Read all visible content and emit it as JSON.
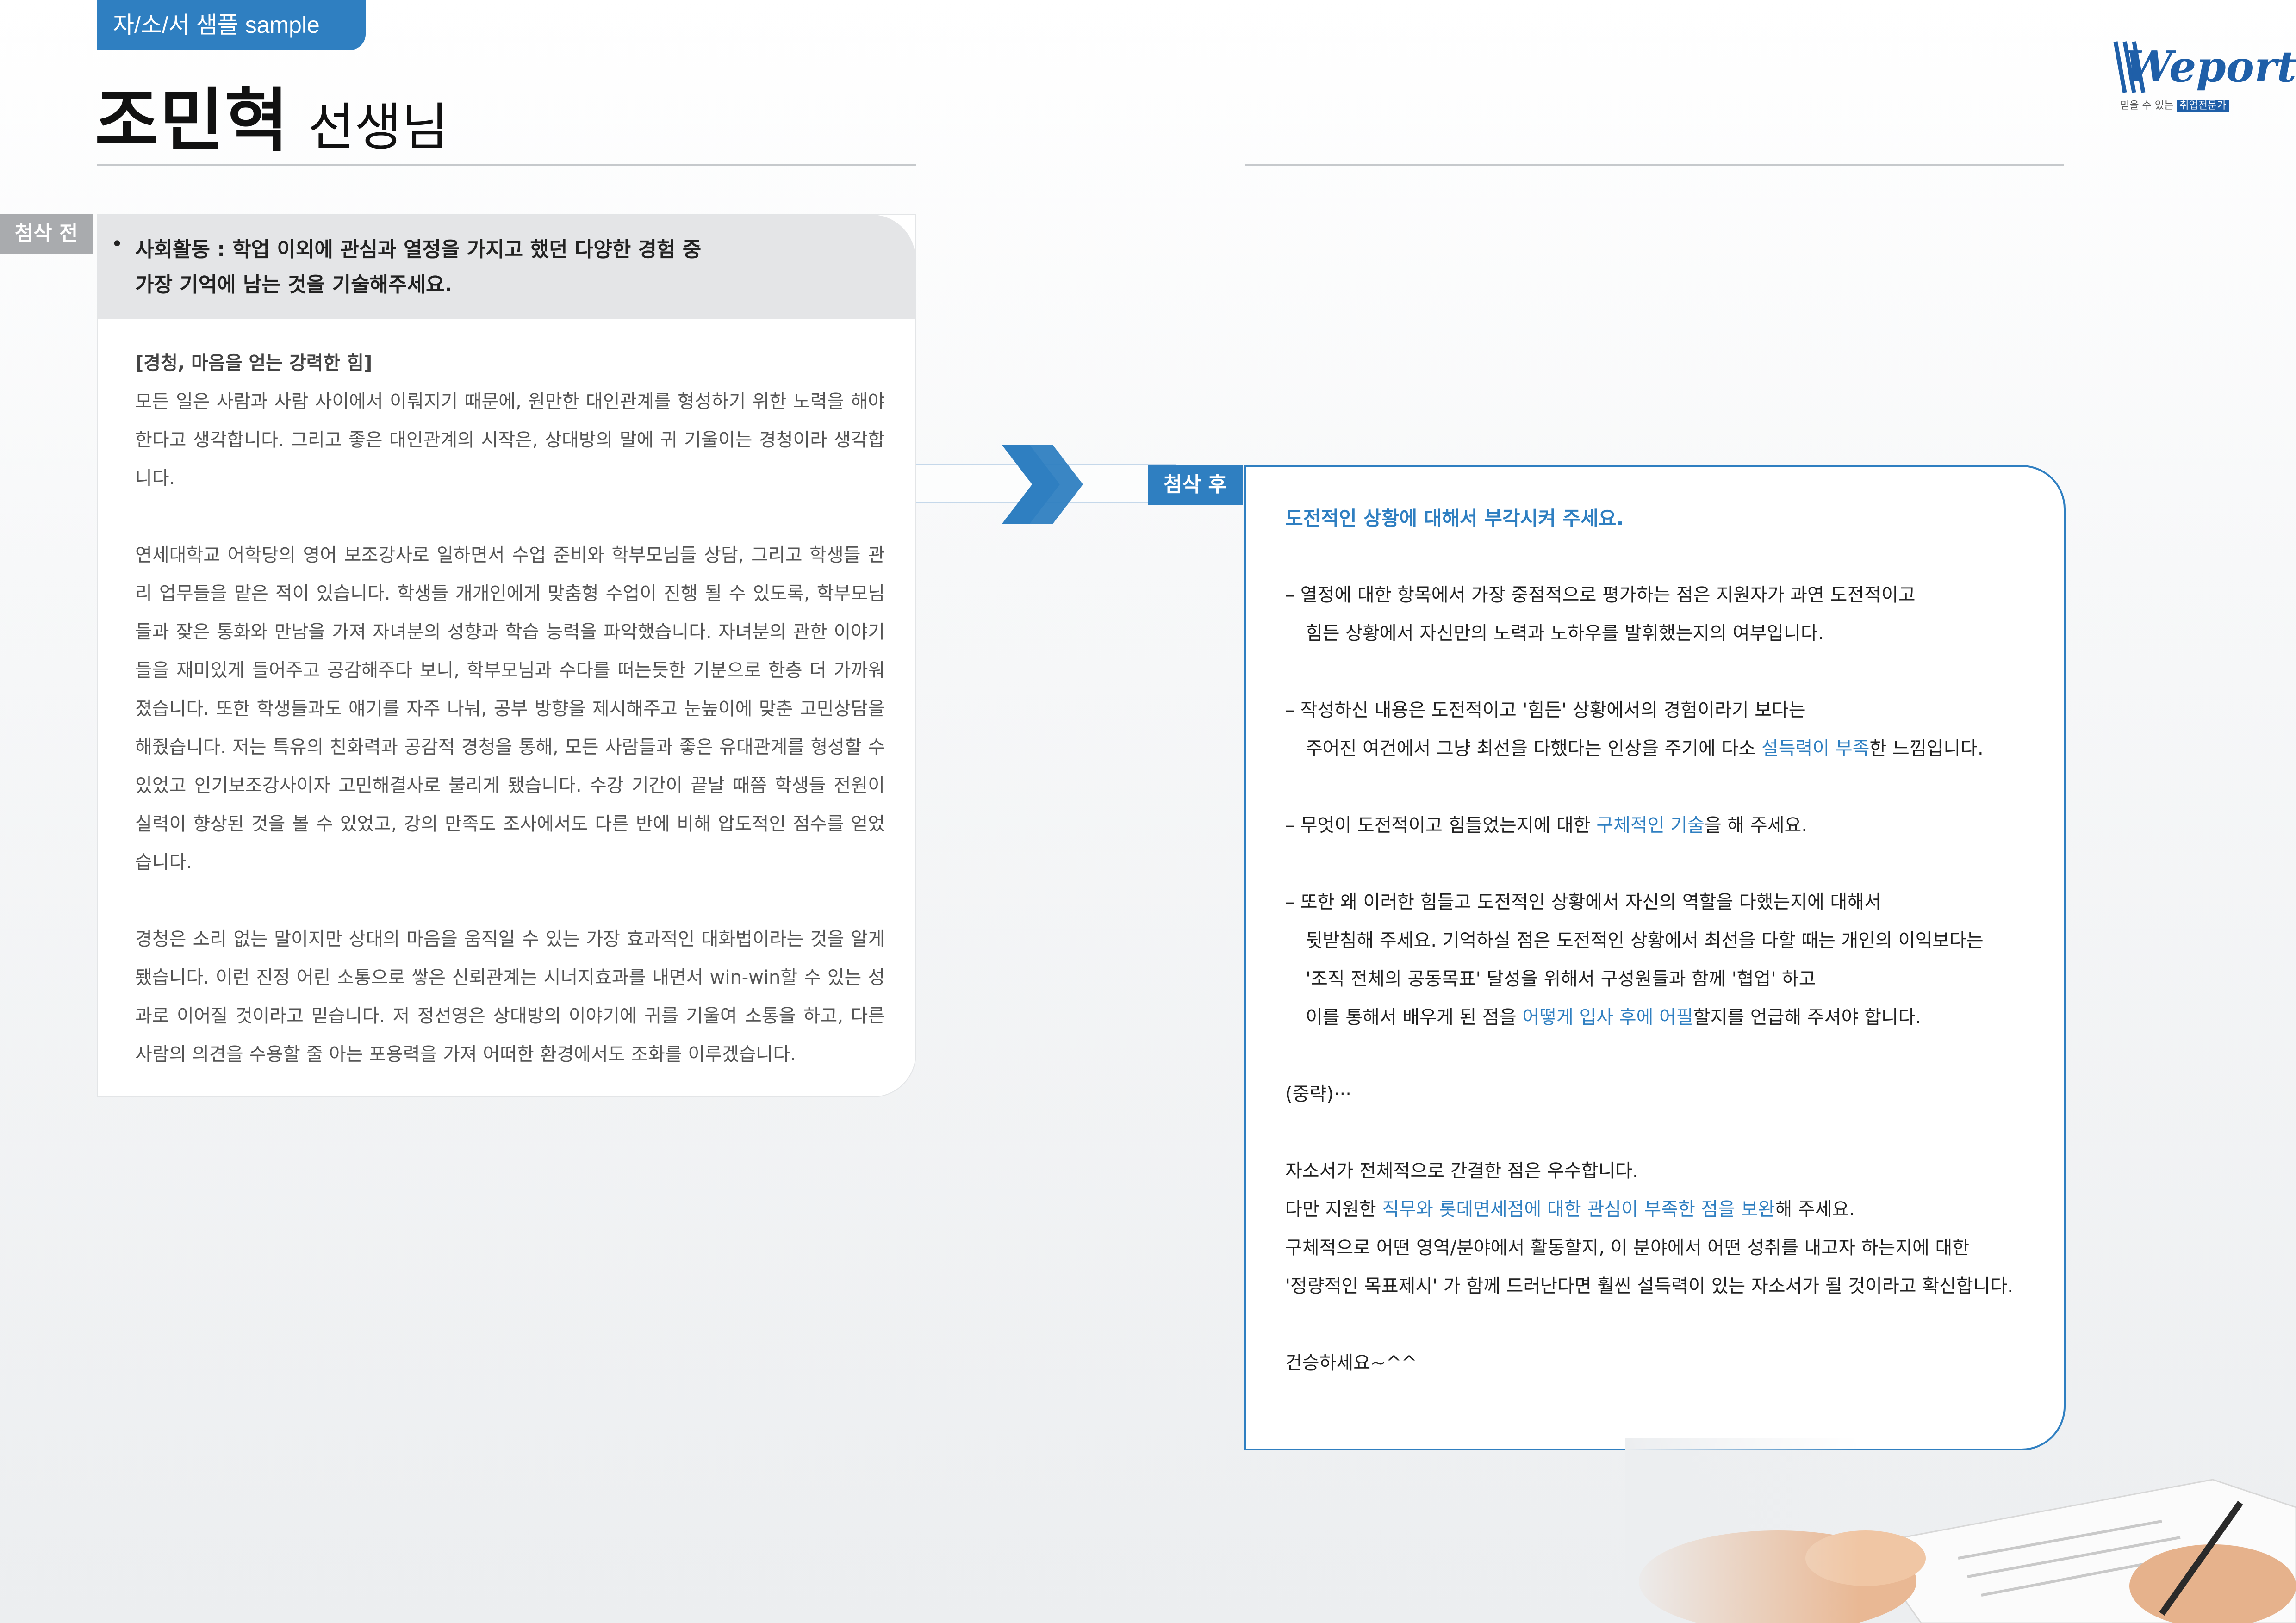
{
  "header": {
    "tag": "자/소/서 샘플 sample",
    "name": "조민혁",
    "suffix": "선생님"
  },
  "logo": {
    "word": "Weport",
    "tagline": "믿을 수 있는",
    "tagline_highlight": "취업전문가"
  },
  "before": {
    "label": "첨삭 전",
    "question_line1": "사회활동 : 학업 이외에 관심과 열정을 가지고 했던 다양한 경험 중",
    "question_line2": "가장 기억에 남는 것을 기술해주세요.",
    "heading": "[경청, 마음을 얻는 강력한 힘]",
    "paragraph1": "모든 일은 사람과 사람 사이에서 이뤄지기 때문에, 원만한 대인관계를 형성하기 위한 노력을 해야 한다고 생각합니다. 그리고 좋은 대인관계의 시작은, 상대방의 말에 귀 기울이는 경청이라 생각합니다.",
    "paragraph2": "연세대학교 어학당의 영어 보조강사로 일하면서 수업 준비와 학부모님들 상담, 그리고 학생들 관리 업무들을 맡은 적이 있습니다. 학생들 개개인에게 맞춤형 수업이 진행 될 수 있도록, 학부모님들과 잦은 통화와 만남을 가져 자녀분의 성향과 학습 능력을 파악했습니다. 자녀분의 관한 이야기들을 재미있게 들어주고 공감해주다 보니, 학부모님과 수다를 떠는듯한 기분으로 한층 더 가까워졌습니다. 또한 학생들과도 얘기를 자주 나눠, 공부 방향을 제시해주고 눈높이에 맞춘 고민상담을 해줬습니다. 저는 특유의 친화력과 공감적 경청을 통해, 모든 사람들과 좋은 유대관계를 형성할 수 있었고 인기보조강사이자 고민해결사로 불리게 됐습니다. 수강 기간이 끝날 때쯤 학생들 전원이 실력이 향상된 것을 볼 수 있었고, 강의 만족도 조사에서도 다른 반에 비해 압도적인 점수를 얻었습니다.",
    "paragraph3": "경청은 소리 없는 말이지만 상대의 마음을 움직일 수 있는 가장 효과적인 대화법이라는 것을 알게 됐습니다. 이런 진정 어린 소통으로 쌓은 신뢰관계는 시너지효과를 내면서 win-win할 수 있는 성과로 이어질 것이라고 믿습니다. 저 정선영은 상대방의 이야기에 귀를 기울여 소통을 하고, 다른 사람의 의견을 수용할 줄 아는 포용력을 가져 어떠한 환경에서도 조화를 이루겠습니다."
  },
  "after": {
    "label": "첨삭 후",
    "lead": "도전적인 상황에 대해서 부각시켜 주세요.",
    "item1_line1": "– 열정에 대한 항목에서 가장 중점적으로 평가하는 점은 지원자가 과연 도전적이고",
    "item1_line2": "힘든 상황에서 자신만의 노력과 노하우를 발휘했는지의 여부입니다.",
    "item2_line1": "– 작성하신 내용은 도전적이고 '힘든' 상황에서의 경험이라기 보다는",
    "item2_line2_a": "주어진 여건에서 그냥 최선을 다했다는 인상을 주기에 다소 ",
    "item2_line2_hl": "설득력이 부족",
    "item2_line2_b": "한 느낌입니다.",
    "item3_a": "– 무엇이 도전적이고 힘들었는지에 대한 ",
    "item3_hl": "구체적인 기술",
    "item3_b": "을 해 주세요.",
    "item4_line1": "– 또한 왜 이러한 힘들고 도전적인 상황에서 자신의 역할을 다했는지에 대해서",
    "item4_line2": "뒷받침해 주세요. 기억하실 점은 도전적인 상황에서 최선을 다할 때는 개인의 이익보다는",
    "item4_line3": "'조직 전체의 공동목표' 달성을 위해서 구성원들과 함께 '협업' 하고",
    "item4_line4_a": "이를 통해서 배우게 된 점을 ",
    "item4_line4_hl": "어떻게 입사 후에 어필",
    "item4_line4_b": "할지를 언급해 주셔야 합니다.",
    "omitted": "(중략)···",
    "close1": "자소서가 전체적으로 간결한 점은 우수합니다.",
    "close2_a": "다만 지원한 ",
    "close2_hl": "직무와 롯데면세점에 대한 관심이 부족한 점을 보완",
    "close2_b": "해 주세요.",
    "close3": "구체적으로 어떤 영역/분야에서 활동할지, 이 분야에서 어떤 성취를 내고자 하는지에 대한",
    "close4": "'정량적인 목표제시' 가 함께 드러난다면 훨씬 설득력이 있는 자소서가 될 것이라고 확신합니다.",
    "signoff": "건승하세요~^^"
  },
  "colors": {
    "accent": "#2f7fc1",
    "before_label": "#a9abae",
    "question_bg": "#e4e5e7"
  }
}
